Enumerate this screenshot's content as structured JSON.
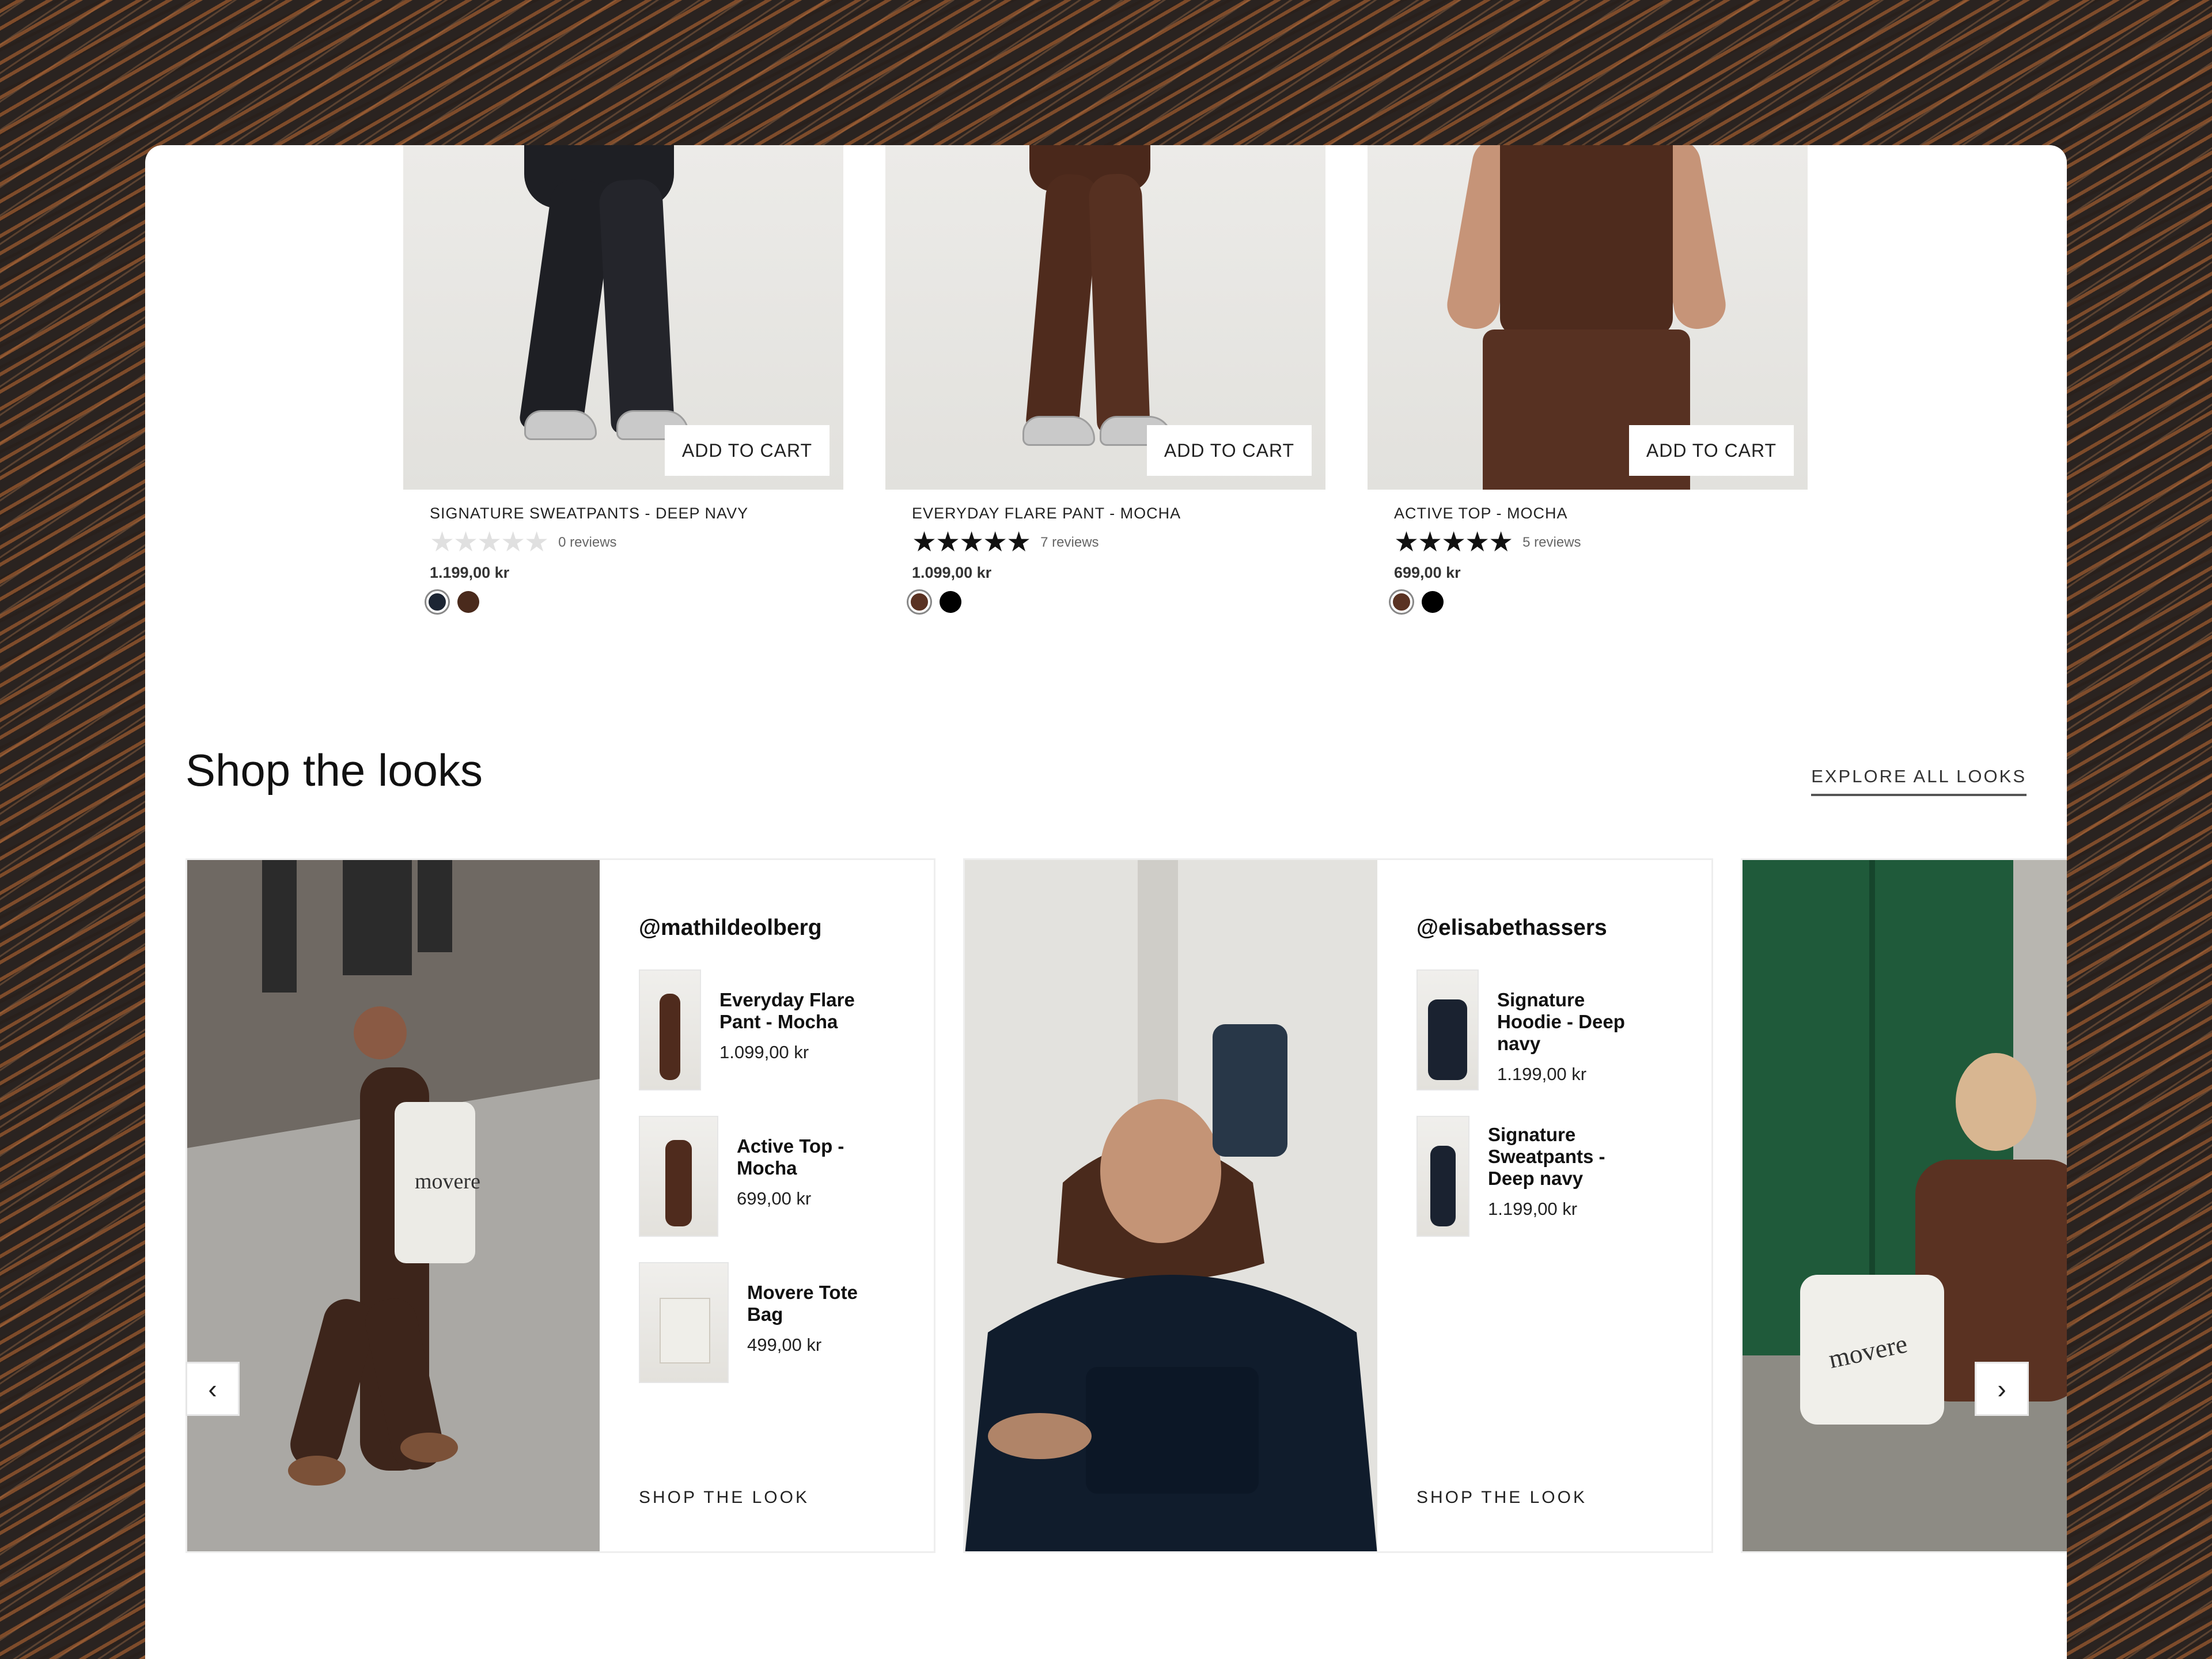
{
  "products": [
    {
      "add_to_cart": "ADD TO CART",
      "name": "SIGNATURE SWEATPANTS - DEEP NAVY",
      "rating": 0,
      "stars": "★★★★★",
      "reviews": "0 reviews",
      "price": "1.199,00 kr",
      "swatches": [
        "#1c2533",
        "#4a2a1c"
      ],
      "selected_swatch": 0
    },
    {
      "add_to_cart": "ADD TO CART",
      "name": "EVERYDAY FLARE PANT - MOCHA",
      "rating": 5,
      "stars": "★★★★★",
      "reviews": "7 reviews",
      "price": "1.099,00 kr",
      "swatches": [
        "#5a3222",
        "#000000"
      ],
      "selected_swatch": 0
    },
    {
      "add_to_cart": "ADD TO CART",
      "name": "ACTIVE TOP - MOCHA",
      "rating": 5,
      "stars": "★★★★★",
      "reviews": "5 reviews",
      "price": "699,00 kr",
      "swatches": [
        "#5a3222",
        "#000000"
      ],
      "selected_swatch": 0
    }
  ],
  "section": {
    "title": "Shop the looks",
    "explore_link": "EXPLORE ALL LOOKS"
  },
  "looks": [
    {
      "handle": "@mathildeolberg",
      "items": [
        {
          "name": "Everyday Flare Pant - Mocha",
          "price": "1.099,00 kr"
        },
        {
          "name": "Active Top - Mocha",
          "price": "699,00 kr"
        },
        {
          "name": "Movere Tote Bag",
          "price": "499,00 kr"
        }
      ],
      "cta": "SHOP THE LOOK"
    },
    {
      "handle": "@elisabethassers",
      "items": [
        {
          "name": "Signature Hoodie - Deep navy",
          "price": "1.199,00 kr"
        },
        {
          "name": "Signature Sweatpants - Deep navy",
          "price": "1.199,00 kr"
        }
      ],
      "cta": "SHOP THE LOOK"
    }
  ],
  "brand_mark": "movere",
  "carousel": {
    "prev_icon": "‹",
    "next_icon": "›"
  },
  "colors": {
    "mocha": "#5a3222",
    "deep_navy": "#1c2533",
    "green_door": "#1f5a3a"
  }
}
